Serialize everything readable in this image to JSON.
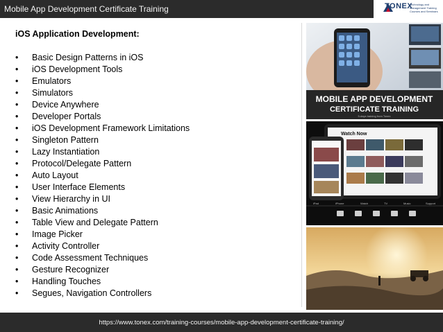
{
  "header": {
    "title": "Mobile App Development Certificate Training"
  },
  "logo": {
    "name": "TONEX",
    "tagline": "Technology and Management Training Courses and Seminars"
  },
  "content": {
    "heading": "iOS Application Development:",
    "bullet": "•",
    "items": [
      "Basic Design Patterns in iOS",
      "iOS Development Tools",
      "Emulators",
      "Simulators",
      "Device Anywhere",
      "Developer Portals",
      "iOS Development Framework Limitations",
      "Singleton Pattern",
      "Lazy Instantiation",
      "Protocol/Delegate Pattern",
      "Auto Layout",
      "User Interface Elements",
      "View Hierarchy in UI",
      "Basic Animations",
      "Table View and Delegate Pattern",
      "Image Picker",
      "Activity Controller",
      "Code Assessment Techniques",
      "Gesture Recognizer",
      "Handling Touches",
      "Segues, Navigation Controllers"
    ]
  },
  "banner": {
    "line1": "MOBILE APP DEVELOPMENT",
    "line2": "CERTIFICATE TRAINING",
    "line3": "5-days training from Tonex"
  },
  "tv_app": {
    "title": "Watch Now",
    "tabs": [
      "iPad",
      "iPhone",
      "Watch",
      "TV",
      "Music",
      "Support"
    ]
  },
  "footer": {
    "url": "https://www.tonex.com/training-courses/mobile-app-development-certificate-training/"
  },
  "colors": {
    "bar": "#2b2b2b",
    "bar_text": "#f2f2f2",
    "brand": "#1d3d6e"
  }
}
